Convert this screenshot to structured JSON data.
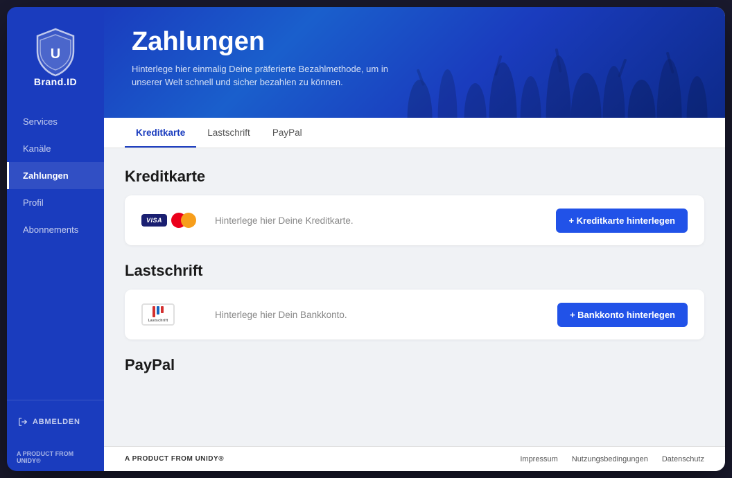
{
  "app": {
    "title": "Brand.ID"
  },
  "sidebar": {
    "brand_name": "Brand.ID",
    "nav_items": [
      {
        "id": "services",
        "label": "Services",
        "active": false
      },
      {
        "id": "kanaele",
        "label": "Kanäle",
        "active": false
      },
      {
        "id": "zahlungen",
        "label": "Zahlungen",
        "active": true
      },
      {
        "id": "profil",
        "label": "Profil",
        "active": false
      },
      {
        "id": "abonnements",
        "label": "Abonnements",
        "active": false
      }
    ],
    "logout_label": "ABMELDEN",
    "footer_prefix": "A PRODUCT FROM ",
    "footer_brand": "UNIDY",
    "footer_symbol": "®"
  },
  "hero": {
    "title": "Zahlungen",
    "subtitle": "Hinterlege hier einmalig Deine präferierte Bezahlmethode, um in unserer Welt schnell und sicher bezahlen zu können."
  },
  "tabs": [
    {
      "id": "kreditkarte",
      "label": "Kreditkarte",
      "active": true
    },
    {
      "id": "lastschrift-tab",
      "label": "Lastschrift",
      "active": false
    },
    {
      "id": "paypal-tab",
      "label": "PayPal",
      "active": false
    }
  ],
  "sections": {
    "kreditkarte": {
      "title": "Kreditkarte",
      "placeholder_text": "Hinterlege hier Deine Kreditkarte.",
      "button_label": "+ Kreditkarte hinterlegen"
    },
    "lastschrift": {
      "title": "Lastschrift",
      "placeholder_text": "Hinterlege hier Dein Bankkonto.",
      "button_label": "+ Bankkonto hinterlegen"
    },
    "paypal": {
      "title": "PayPal"
    }
  },
  "footer": {
    "prefix": "A PRODUCT FROM ",
    "brand": "UNIDY",
    "symbol": "®",
    "links": [
      {
        "id": "impressum",
        "label": "Impressum"
      },
      {
        "id": "nutzungsbedingungen",
        "label": "Nutzungsbedingungen"
      },
      {
        "id": "datenschutz",
        "label": "Datenschutz"
      }
    ]
  },
  "colors": {
    "brand_blue": "#1a3cbe",
    "button_blue": "#2152e8"
  }
}
